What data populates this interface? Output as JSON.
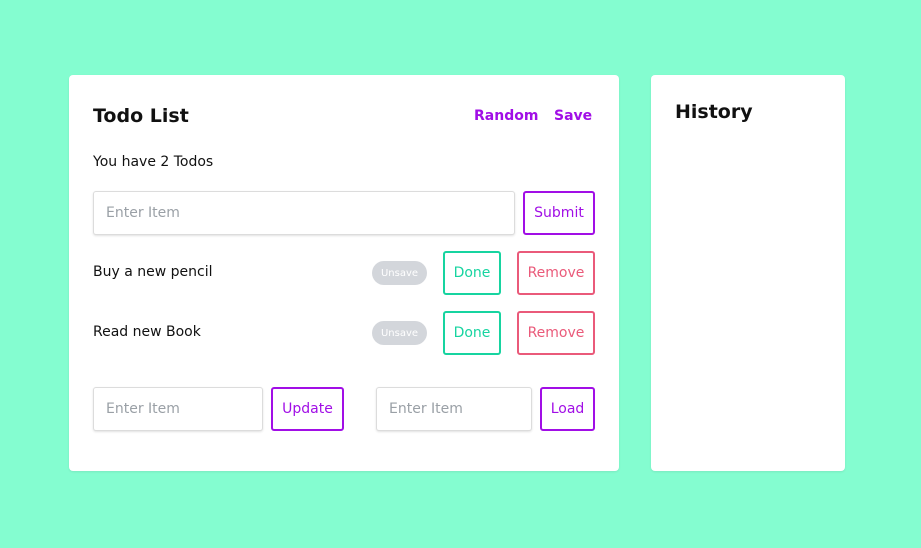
{
  "todo": {
    "title": "Todo List",
    "random_label": "Random",
    "save_label": "Save",
    "count_text": "You have 2 Todos",
    "input_placeholder": "Enter Item",
    "submit_label": "Submit",
    "items": [
      {
        "text": "Buy a new pencil",
        "badge": "Unsave",
        "done_label": "Done",
        "remove_label": "Remove"
      },
      {
        "text": "Read new Book",
        "badge": "Unsave",
        "done_label": "Done",
        "remove_label": "Remove"
      }
    ],
    "update_placeholder": "Enter Item",
    "update_label": "Update",
    "load_placeholder": "Enter Item",
    "load_label": "Load"
  },
  "history": {
    "title": "History"
  },
  "colors": {
    "background": "#84fdd0",
    "accent": "#a10ee6",
    "done": "#17d4a0",
    "remove": "#ea5a7a",
    "badge": "#d3d6db"
  }
}
